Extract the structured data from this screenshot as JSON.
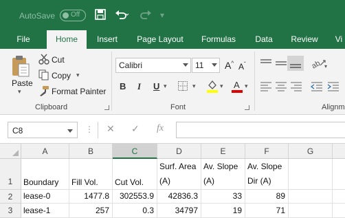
{
  "titlebar": {
    "autosave_label": "AutoSave",
    "autosave_state": "Off",
    "save_icon": "save-icon",
    "undo_icon": "undo-icon",
    "redo_icon": "redo-icon",
    "brand_color": "#217346"
  },
  "tabs": [
    "File",
    "Home",
    "Insert",
    "Page Layout",
    "Formulas",
    "Data",
    "Review",
    "Vi"
  ],
  "active_tab": "Home",
  "ribbon": {
    "clipboard": {
      "label": "Clipboard",
      "paste": "Paste",
      "cut": "Cut",
      "copy": "Copy",
      "format_painter": "Format Painter"
    },
    "font": {
      "label": "Font",
      "font_name": "Calibri",
      "font_size": "11",
      "bold": "B",
      "italic": "I",
      "underline": "U"
    },
    "alignment": {
      "label": "Alignm"
    }
  },
  "formula_bar": {
    "name_box": "C8",
    "fx": "fx",
    "cancel": "✕",
    "enter": "✓",
    "content": ""
  },
  "grid": {
    "columns": [
      "A",
      "B",
      "C",
      "D",
      "E",
      "F",
      "G"
    ],
    "selected_column": "C",
    "rows": [
      {
        "num": "1",
        "cells": [
          "Boundary",
          "Fill Vol.",
          "Cut Vol.",
          "Surf. Area (A)",
          "Av. Slope (A)",
          "Av. Slope Dir (A)",
          ""
        ]
      },
      {
        "num": "2",
        "cells": [
          "lease-0",
          "1477.8",
          "302553.9",
          "42836.3",
          "33",
          "89",
          ""
        ]
      },
      {
        "num": "3",
        "cells": [
          "lease-1",
          "257",
          "0.3",
          "34797",
          "19",
          "71",
          ""
        ]
      }
    ]
  }
}
